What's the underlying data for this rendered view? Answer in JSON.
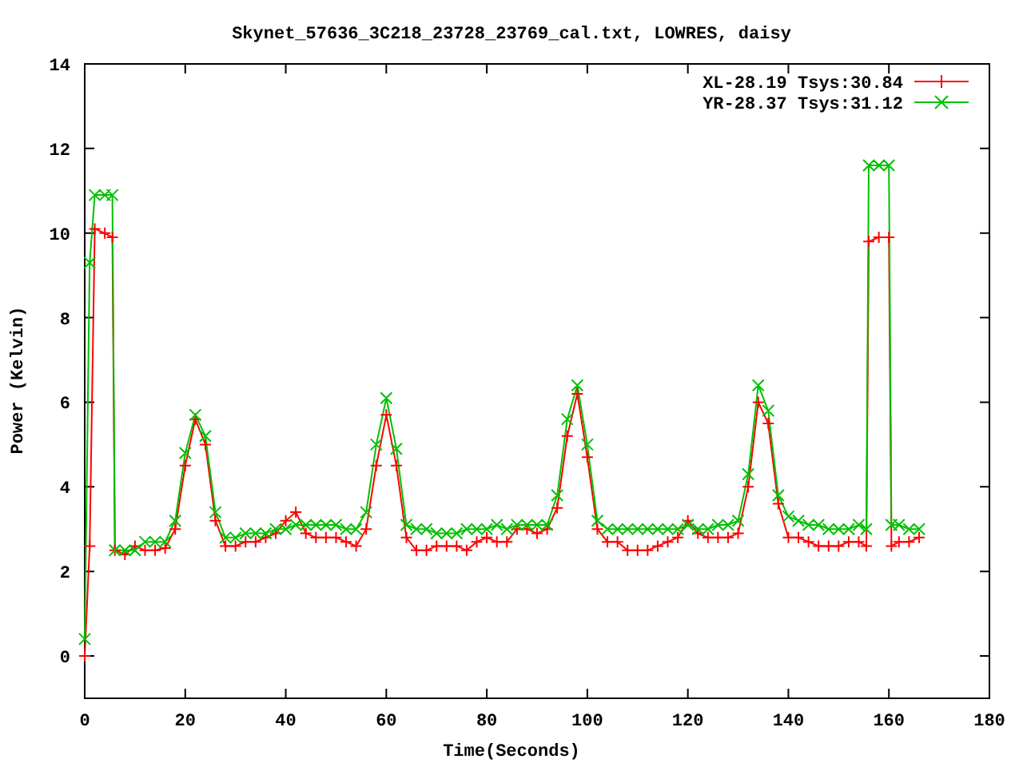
{
  "plot": {
    "chart_data": {
      "type": "line",
      "title": "Skynet_57636_3C218_23728_23769_cal.txt, LOWRES, daisy",
      "xlabel": "Time(Seconds)",
      "ylabel": "Power (Kelvin)",
      "x": [
        0,
        1,
        2,
        4,
        5.5,
        6,
        8,
        10,
        12,
        14,
        16,
        18,
        20,
        22,
        24,
        26,
        28,
        30,
        32,
        34,
        36,
        38,
        40,
        42,
        44,
        46,
        48,
        50,
        52,
        54,
        56,
        58,
        60,
        62,
        64,
        66,
        68,
        70,
        72,
        74,
        76,
        78,
        80,
        82,
        84,
        86,
        88,
        90,
        92,
        94,
        96,
        98,
        100,
        102,
        104,
        106,
        108,
        110,
        112,
        114,
        116,
        118,
        120,
        122,
        124,
        126,
        128,
        130,
        132,
        134,
        136,
        138,
        140,
        142,
        144,
        146,
        148,
        150,
        152,
        154,
        155.5,
        156,
        158,
        160,
        160.5,
        162,
        164,
        166
      ],
      "series": [
        {
          "name": "XL-28.19 Tsys:30.84",
          "color": "#ff0000",
          "marker": "plus",
          "values": [
            0,
            2.6,
            10.1,
            10.0,
            9.9,
            2.5,
            2.4,
            2.6,
            2.5,
            2.5,
            2.55,
            3.0,
            4.5,
            5.6,
            5.0,
            3.2,
            2.6,
            2.6,
            2.7,
            2.7,
            2.8,
            2.9,
            3.2,
            3.4,
            2.9,
            2.8,
            2.8,
            2.8,
            2.7,
            2.6,
            3.0,
            4.5,
            5.7,
            4.5,
            2.8,
            2.5,
            2.5,
            2.6,
            2.6,
            2.6,
            2.5,
            2.7,
            2.8,
            2.7,
            2.7,
            3.0,
            3.0,
            2.9,
            3.0,
            3.5,
            5.2,
            6.2,
            4.7,
            3.0,
            2.7,
            2.7,
            2.5,
            2.5,
            2.5,
            2.6,
            2.7,
            2.8,
            3.2,
            2.9,
            2.8,
            2.8,
            2.8,
            2.9,
            4.0,
            6.0,
            5.5,
            3.6,
            2.8,
            2.8,
            2.7,
            2.6,
            2.6,
            2.6,
            2.7,
            2.7,
            2.6,
            9.8,
            9.9,
            9.9,
            2.6,
            2.7,
            2.7,
            2.8
          ]
        },
        {
          "name": "YR-28.37 Tsys:31.12",
          "color": "#00c000",
          "marker": "cross",
          "values": [
            0.4,
            9.3,
            10.9,
            10.9,
            10.9,
            2.5,
            2.5,
            2.5,
            2.7,
            2.7,
            2.7,
            3.2,
            4.8,
            5.7,
            5.2,
            3.4,
            2.8,
            2.8,
            2.9,
            2.9,
            2.9,
            3.0,
            3.0,
            3.1,
            3.1,
            3.1,
            3.1,
            3.1,
            3.0,
            3.0,
            3.4,
            5.0,
            6.1,
            4.9,
            3.1,
            3.0,
            3.0,
            2.9,
            2.9,
            2.9,
            3.0,
            3.0,
            3.0,
            3.1,
            3.0,
            3.1,
            3.1,
            3.1,
            3.1,
            3.8,
            5.6,
            6.4,
            5.0,
            3.2,
            3.0,
            3.0,
            3.0,
            3.0,
            3.0,
            3.0,
            3.0,
            3.0,
            3.1,
            3.0,
            3.0,
            3.1,
            3.1,
            3.2,
            4.3,
            6.4,
            5.8,
            3.8,
            3.3,
            3.2,
            3.1,
            3.1,
            3.0,
            3.0,
            3.0,
            3.1,
            3.0,
            11.6,
            11.6,
            11.6,
            3.1,
            3.1,
            3.0,
            3.0
          ]
        }
      ],
      "legend": true,
      "xlim": [
        0,
        180
      ],
      "ylim": [
        -1,
        14
      ],
      "xticks": [
        0,
        20,
        40,
        60,
        80,
        100,
        120,
        140,
        160,
        180
      ],
      "yticks": [
        0,
        2,
        4,
        6,
        8,
        10,
        12,
        14
      ]
    }
  }
}
